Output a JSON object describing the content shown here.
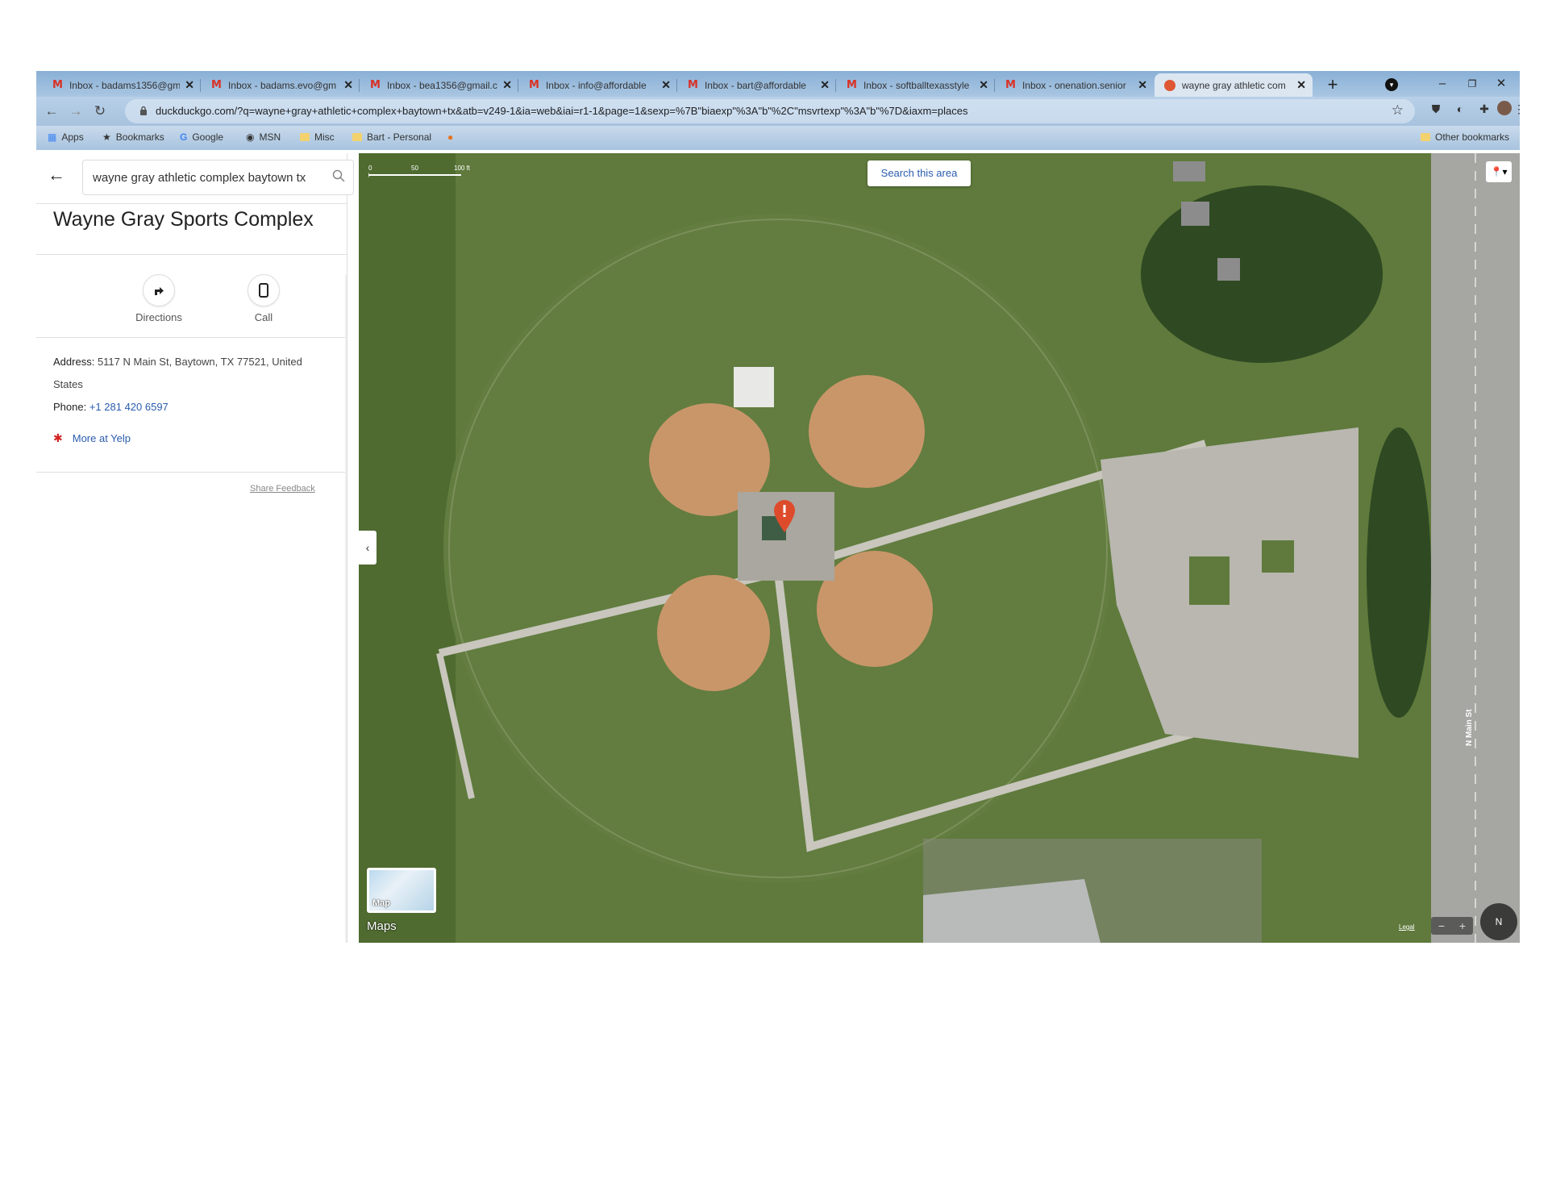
{
  "tabs": [
    {
      "title": "Inbox - badams1356@gm",
      "icon": "gmail-icon"
    },
    {
      "title": "Inbox - badams.evo@gm",
      "icon": "gmail-icon"
    },
    {
      "title": "Inbox - bea1356@gmail.c",
      "icon": "gmail-icon"
    },
    {
      "title": "Inbox - info@affordable",
      "icon": "gmail-icon"
    },
    {
      "title": "Inbox - bart@affordable",
      "icon": "gmail-icon"
    },
    {
      "title": "Inbox - softballtexasstyle",
      "icon": "gmail-icon"
    },
    {
      "title": "Inbox - onenation.senior",
      "icon": "gmail-icon"
    },
    {
      "title": "wayne gray athletic com",
      "icon": "duckduckgo-icon",
      "active": true
    }
  ],
  "toolbar": {
    "url": "duckduckgo.com/?q=wayne+gray+athletic+complex+baytown+tx&atb=v249-1&ia=web&iai=r1-1&page=1&sexp=%7B\"biaexp\"%3A\"b\"%2C\"msvrtexp\"%3A\"b\"%7D&iaxm=places"
  },
  "bookmarks": {
    "items": [
      "Apps",
      "Bookmarks",
      "Google",
      "MSN",
      "Misc",
      "Bart - Personal"
    ],
    "other": "Other bookmarks"
  },
  "sidebar": {
    "search_value": "wayne gray athletic complex baytown tx",
    "place_title": "Wayne Gray Sports Complex",
    "actions": {
      "directions": "Directions",
      "call": "Call"
    },
    "address_label": "Address:",
    "address_value": "5117 N Main St, Baytown, TX 77521, United States",
    "phone_label": "Phone:",
    "phone_value": "+1 281 420 6597",
    "yelp_link": "More at Yelp",
    "feedback": "Share Feedback"
  },
  "map": {
    "scale": {
      "zero": "0",
      "mid": "50",
      "end": "100 ft"
    },
    "search_area": "Search this area",
    "thumb_label": "Map",
    "brand": "Maps",
    "legal": "Legal",
    "road_label": "N Main St",
    "compass": "N",
    "colors": {
      "grass": "#5f7a3c",
      "infield": "#c9966a",
      "concrete": "#b9b7b0",
      "trees": "#2f4a22"
    }
  }
}
